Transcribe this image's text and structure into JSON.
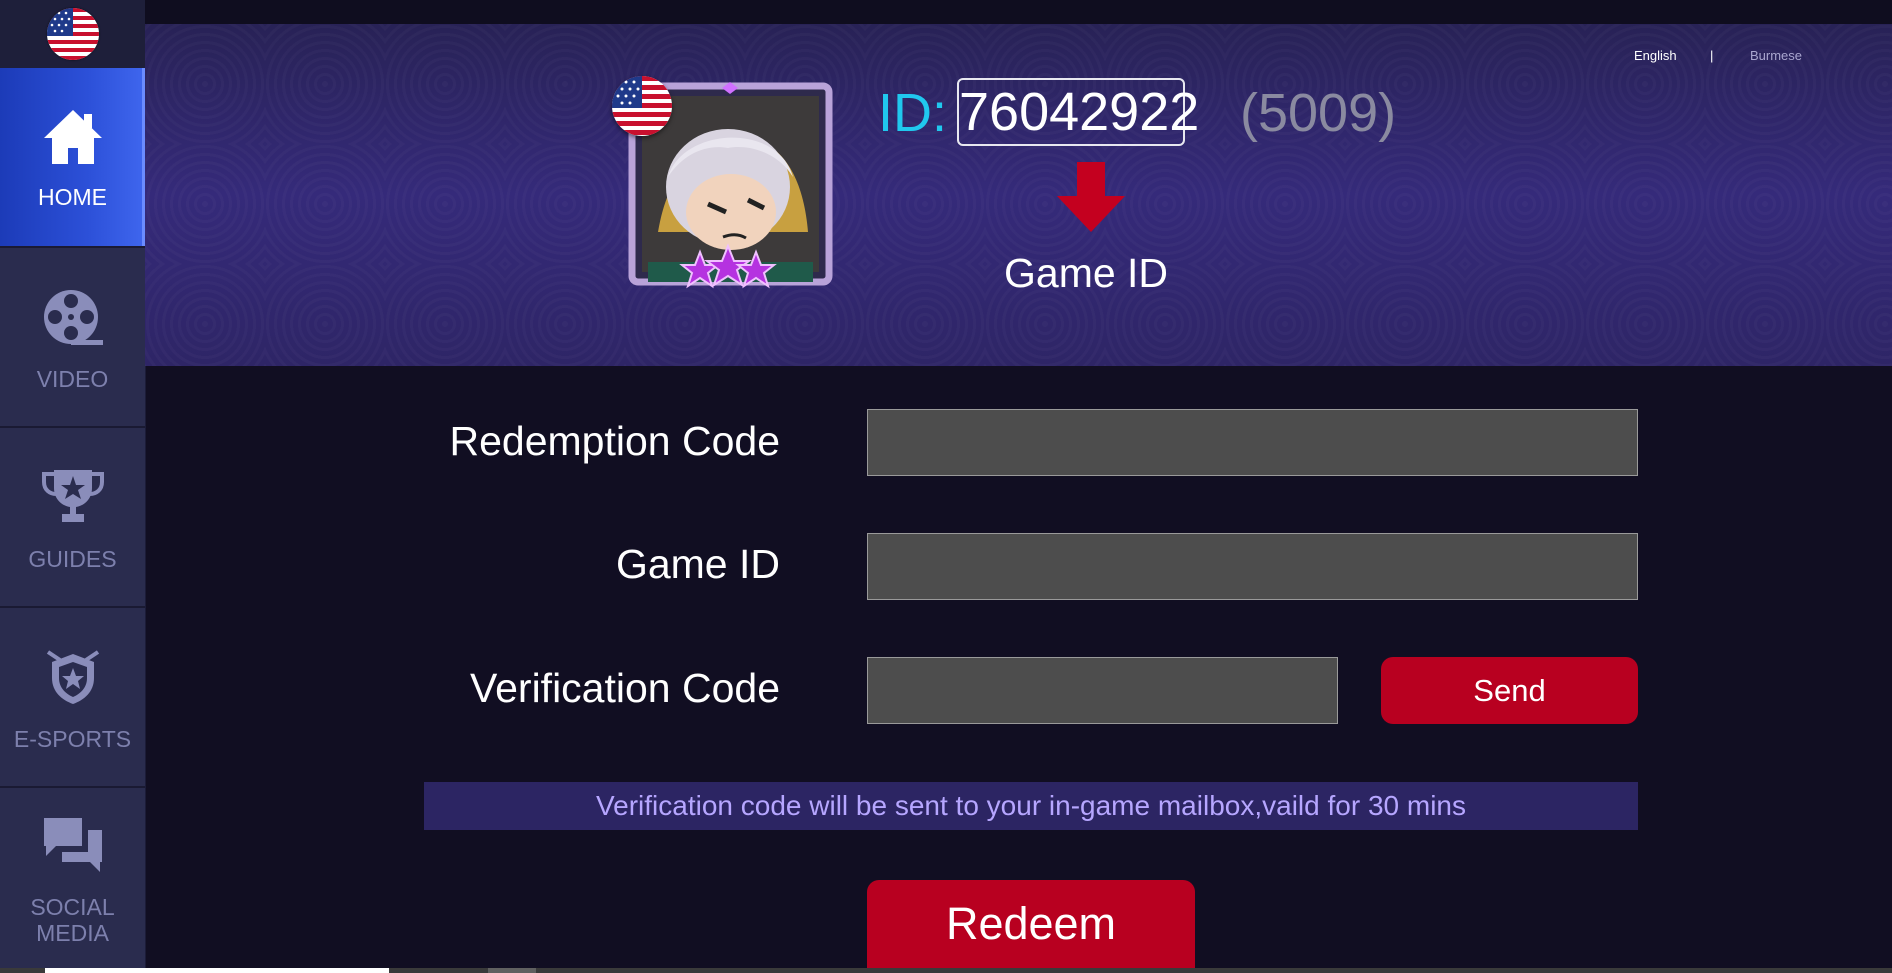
{
  "sidebar": {
    "items": [
      {
        "label": "HOME",
        "icon": "home-icon",
        "active": true
      },
      {
        "label": "VIDEO",
        "icon": "film-reel-icon",
        "active": false
      },
      {
        "label": "GUIDES",
        "icon": "trophy-icon",
        "active": false
      },
      {
        "label": "E-SPORTS",
        "icon": "shield-star-icon",
        "active": false
      },
      {
        "label": "SOCIAL MEDIA",
        "icon": "chat-bubbles-icon",
        "active": false
      }
    ]
  },
  "language": {
    "english": "English",
    "separator": "|",
    "burmese": "Burmese"
  },
  "profile": {
    "id_label": "ID:",
    "id_value": "76042922",
    "zone": "(5009)",
    "caption": "Game ID"
  },
  "form": {
    "redemption_label": "Redemption Code",
    "gameid_label": "Game ID",
    "verification_label": "Verification Code",
    "redemption_value": "",
    "gameid_value": "",
    "verification_value": "",
    "send_label": "Send",
    "notice": "Verification code will be sent to your in-game mailbox,vaild for 30 mins",
    "redeem_label": "Redeem"
  },
  "colors": {
    "accent_red": "#b80020",
    "id_cyan": "#20c8ee",
    "notice_bg": "#2c2563",
    "active_nav": "#2c50d8"
  }
}
